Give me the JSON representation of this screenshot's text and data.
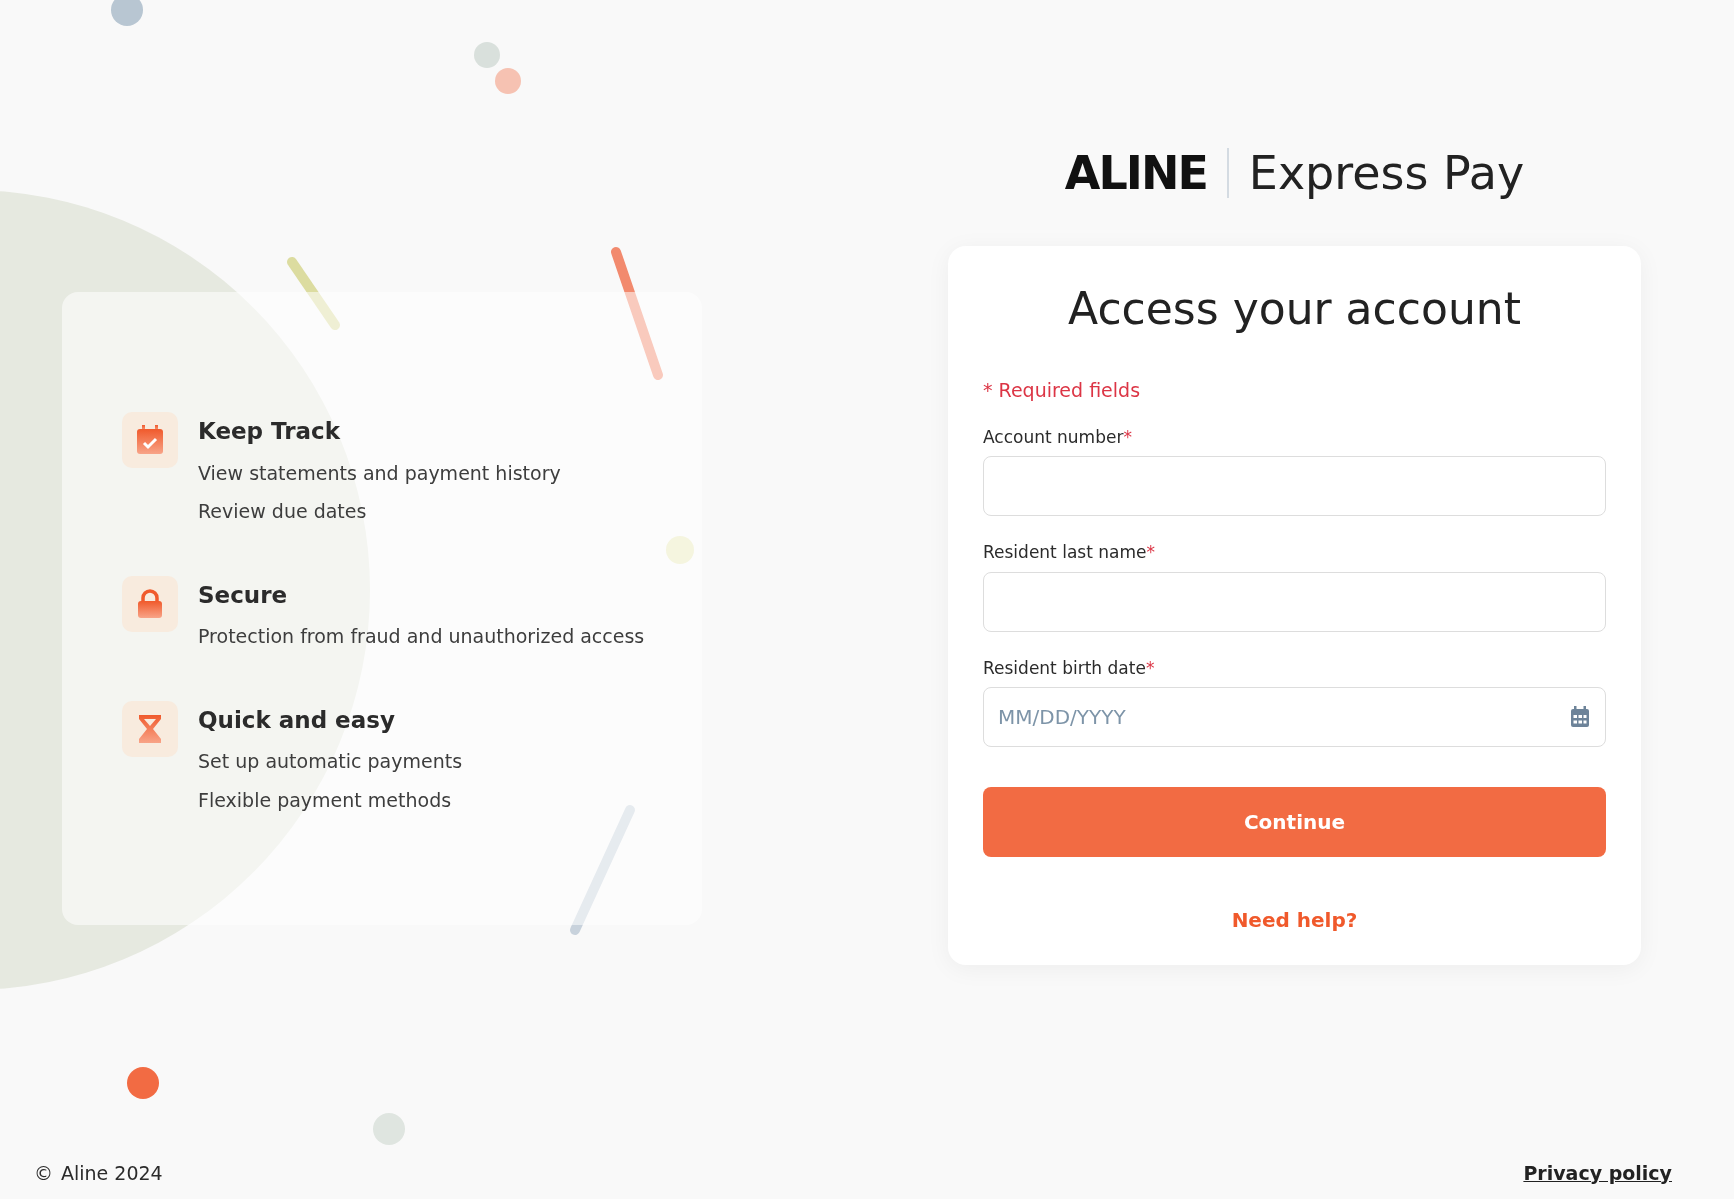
{
  "brand": {
    "logo": "ALINE",
    "product": "Express Pay"
  },
  "features": [
    {
      "title": "Keep Track",
      "lines": [
        "View statements and payment history",
        "Review due dates"
      ]
    },
    {
      "title": "Secure",
      "lines": [
        "Protection from fraud and unauthorized access"
      ]
    },
    {
      "title": "Quick and easy",
      "lines": [
        "Set up automatic payments",
        "Flexible payment methods"
      ]
    }
  ],
  "form": {
    "title": "Access your account",
    "required_note": "* Required fields",
    "fields": [
      {
        "kind": "text",
        "label": "Account number",
        "required_mark": "*"
      },
      {
        "kind": "text",
        "label": "Resident last name",
        "required_mark": "*"
      },
      {
        "kind": "date",
        "label": "Resident birth date",
        "required_mark": "*",
        "placeholder": "MM/DD/YYYY"
      }
    ],
    "submit": "Continue",
    "help_link": "Need help?"
  },
  "footer": {
    "copyright_symbol": "©",
    "copyright": "Aline 2024",
    "privacy_link": "Privacy policy"
  }
}
